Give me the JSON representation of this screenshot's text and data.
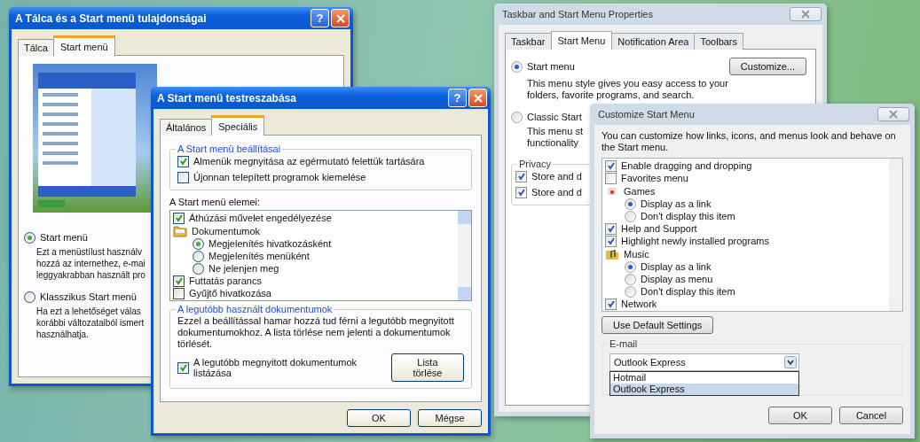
{
  "windows": [
    {
      "kind": "xp",
      "title": "A Tálca és a Start menü tulajdonságai",
      "title_buttons": [
        {
          "kind": "help",
          "text": "?"
        },
        {
          "kind": "close"
        }
      ],
      "tabs": [
        {
          "label": "Tálca",
          "selected": false
        },
        {
          "label": "Start menü",
          "selected": true
        }
      ],
      "body": [
        {
          "kind": "preview"
        },
        {
          "kind": "radio",
          "label": "Start menü",
          "selected": true
        },
        {
          "kind": "lines",
          "lines": [
            "Ezt a menüstílust használv",
            "hozzá az internethez, e-mai",
            "leggyakrabban használt pro"
          ]
        },
        {
          "kind": "radio",
          "label": "Klasszikus Start menü",
          "selected": false
        },
        {
          "kind": "lines",
          "lines": [
            "Ha ezt a lehetőséget válas",
            "korábbi változataiból ismert",
            "használhatja."
          ]
        }
      ]
    },
    {
      "kind": "xp",
      "title": "A Start menü testreszabása",
      "title_buttons": [
        {
          "kind": "help",
          "text": "?"
        },
        {
          "kind": "close"
        }
      ],
      "tabs": [
        {
          "label": "Általános",
          "selected": false
        },
        {
          "label": "Speciális",
          "selected": true
        }
      ],
      "body": [
        {
          "kind": "group",
          "title": "A Start menü beállításai",
          "items": [
            {
              "kind": "check",
              "label": "Almenük megnyitása az egérmutató felettük tartására",
              "checked": true
            },
            {
              "kind": "check",
              "label": "Újonnan telepített programok kiemelése",
              "checked": false
            }
          ]
        },
        {
          "kind": "label",
          "text": "A Start menü elemei:"
        },
        {
          "kind": "list",
          "items": [
            {
              "kind": "check",
              "label": "Áthúzási művelet engedélyezése",
              "checked": true
            },
            {
              "kind": "folder",
              "label": "Dokumentumok"
            },
            {
              "kind": "option",
              "label": "Megjelenítés hivatkozásként",
              "selected": true
            },
            {
              "kind": "option",
              "label": "Megjelenítés menüként",
              "selected": false
            },
            {
              "kind": "option",
              "label": "Ne jelenjen meg",
              "selected": false
            },
            {
              "kind": "check",
              "label": "Futtatás parancs",
              "checked": true
            },
            {
              "kind": "check",
              "label": "Gyűjtő hivatkozása",
              "checked": false
            }
          ]
        },
        {
          "kind": "group",
          "title": "A legutóbb használt dokumentumok",
          "items": [
            {
              "kind": "para",
              "text": "Ezzel a beállítással hamar hozzá tud férni a legutóbb megnyitott dokumentumokhoz.  A lista törlése nem jelenti a dokumentumok törlését."
            },
            {
              "kind": "check",
              "label": "A legutóbb megnyitott dokumentumok listázása",
              "checked": true,
              "button": "Lista törlése"
            }
          ]
        }
      ],
      "footer_buttons": [
        "OK",
        "Mégse"
      ]
    },
    {
      "kind": "vista",
      "title": "Taskbar and Start Menu Properties",
      "title_buttons": [
        {
          "kind": "close"
        }
      ],
      "tabs": [
        {
          "label": "Taskbar",
          "selected": false
        },
        {
          "label": "Start Menu",
          "selected": true
        },
        {
          "label": "Notification Area",
          "selected": false
        },
        {
          "label": "Toolbars",
          "selected": false
        }
      ],
      "body": [
        {
          "kind": "radio",
          "label": "Start menu",
          "selected": true,
          "button": "Customize..."
        },
        {
          "kind": "lines",
          "lines": [
            "This menu style gives you easy access to your",
            "folders, favorite programs, and search."
          ]
        },
        {
          "kind": "radio",
          "label": "Classic Start",
          "selected": false
        },
        {
          "kind": "lines",
          "lines": [
            "This menu st",
            "functionality"
          ]
        },
        {
          "kind": "group",
          "title": "Privacy",
          "items": [
            {
              "kind": "check",
              "label": "Store and d",
              "checked": true
            },
            {
              "kind": "check",
              "label": "Store and d",
              "checked": true
            }
          ]
        }
      ]
    },
    {
      "kind": "vista",
      "title": "Customize Start Menu",
      "title_buttons": [
        {
          "kind": "close"
        }
      ],
      "body": [
        {
          "kind": "para",
          "text": "You can customize how links, icons, and menus look and behave on the Start menu."
        },
        {
          "kind": "list",
          "items": [
            {
              "kind": "check",
              "label": "Enable dragging and dropping",
              "checked": true
            },
            {
              "kind": "check",
              "label": "Favorites menu",
              "checked": false
            },
            {
              "kind": "games",
              "label": "Games"
            },
            {
              "kind": "option",
              "label": "Display as a link",
              "selected": true
            },
            {
              "kind": "option",
              "label": "Don't display this item",
              "selected": false
            },
            {
              "kind": "check",
              "label": "Help and Support",
              "checked": true
            },
            {
              "kind": "check",
              "label": "Highlight newly installed programs",
              "checked": true
            },
            {
              "kind": "music",
              "label": "Music"
            },
            {
              "kind": "option",
              "label": "Display as a link",
              "selected": true
            },
            {
              "kind": "option",
              "label": "Display as menu",
              "selected": false
            },
            {
              "kind": "option",
              "label": "Don't display this item",
              "selected": false
            },
            {
              "kind": "check",
              "label": "Network",
              "checked": true
            }
          ]
        },
        {
          "kind": "button",
          "label": "Use Default Settings"
        },
        {
          "kind": "group",
          "title": "E-mail",
          "items": [
            {
              "kind": "combo",
              "value": "Outlook Express",
              "options": [
                {
                  "label": "Hotmail",
                  "selected": false
                },
                {
                  "label": "Outlook Express",
                  "selected": true
                }
              ]
            }
          ]
        }
      ],
      "footer_buttons": [
        "OK",
        "Cancel"
      ]
    }
  ]
}
